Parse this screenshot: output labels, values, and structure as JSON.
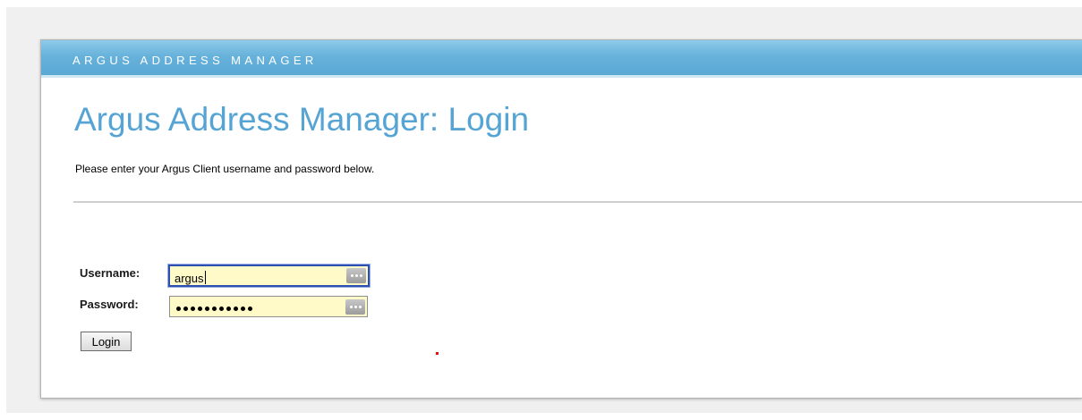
{
  "header": {
    "brand": "ARGUS ADDRESS MANAGER"
  },
  "page": {
    "title": "Argus Address Manager: Login",
    "intro": "Please enter your Argus Client username and password below."
  },
  "form": {
    "username_label": "Username:",
    "username_value": "argus",
    "password_label": "Password:",
    "password_masked_length": 11,
    "login_label": "Login"
  },
  "colors": {
    "brand_bar": "#67b2db",
    "title": "#55a4d4",
    "input_background": "#fffac8",
    "focus_border": "#2c4fb0"
  },
  "icons": {
    "password_manager": "key-dots-icon"
  }
}
